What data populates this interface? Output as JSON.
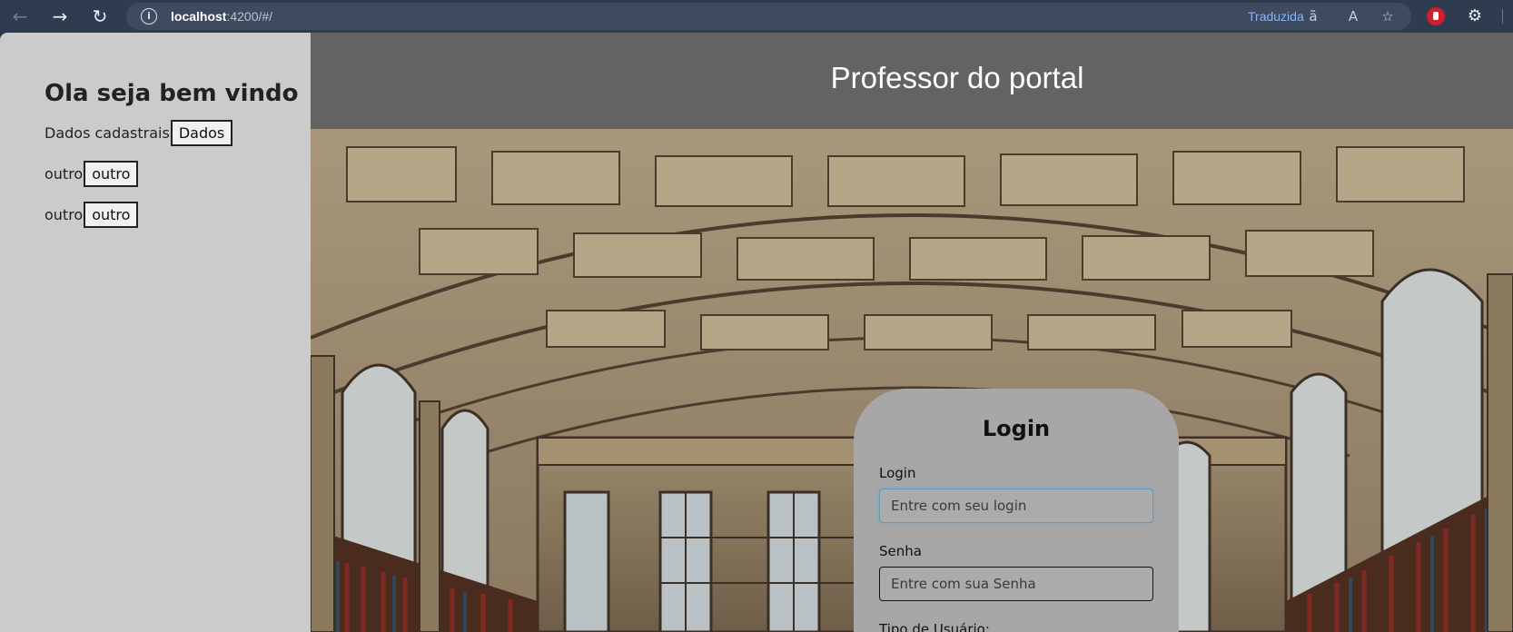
{
  "browser": {
    "url_host": "localhost",
    "url_rest": ":4200/#/",
    "translated_label": "Traduzida"
  },
  "sidebar": {
    "welcome": "Ola seja bem vindo",
    "rows": [
      {
        "label": "Dados cadastrais",
        "button": "Dados"
      },
      {
        "label": "outro",
        "button": "outro"
      },
      {
        "label": "outro",
        "button": "outro"
      }
    ]
  },
  "header": {
    "title": "Professor do portal"
  },
  "login": {
    "title": "Login",
    "login_label": "Login",
    "login_placeholder": "Entre com seu login",
    "password_label": "Senha",
    "password_placeholder": "Entre com sua Senha",
    "user_type_label": "Tipo de Usuário:"
  },
  "colors": {
    "sidebar_bg": "#cbcbcb",
    "header_bg": "#636363",
    "card_bg": "#a7a7a7"
  }
}
